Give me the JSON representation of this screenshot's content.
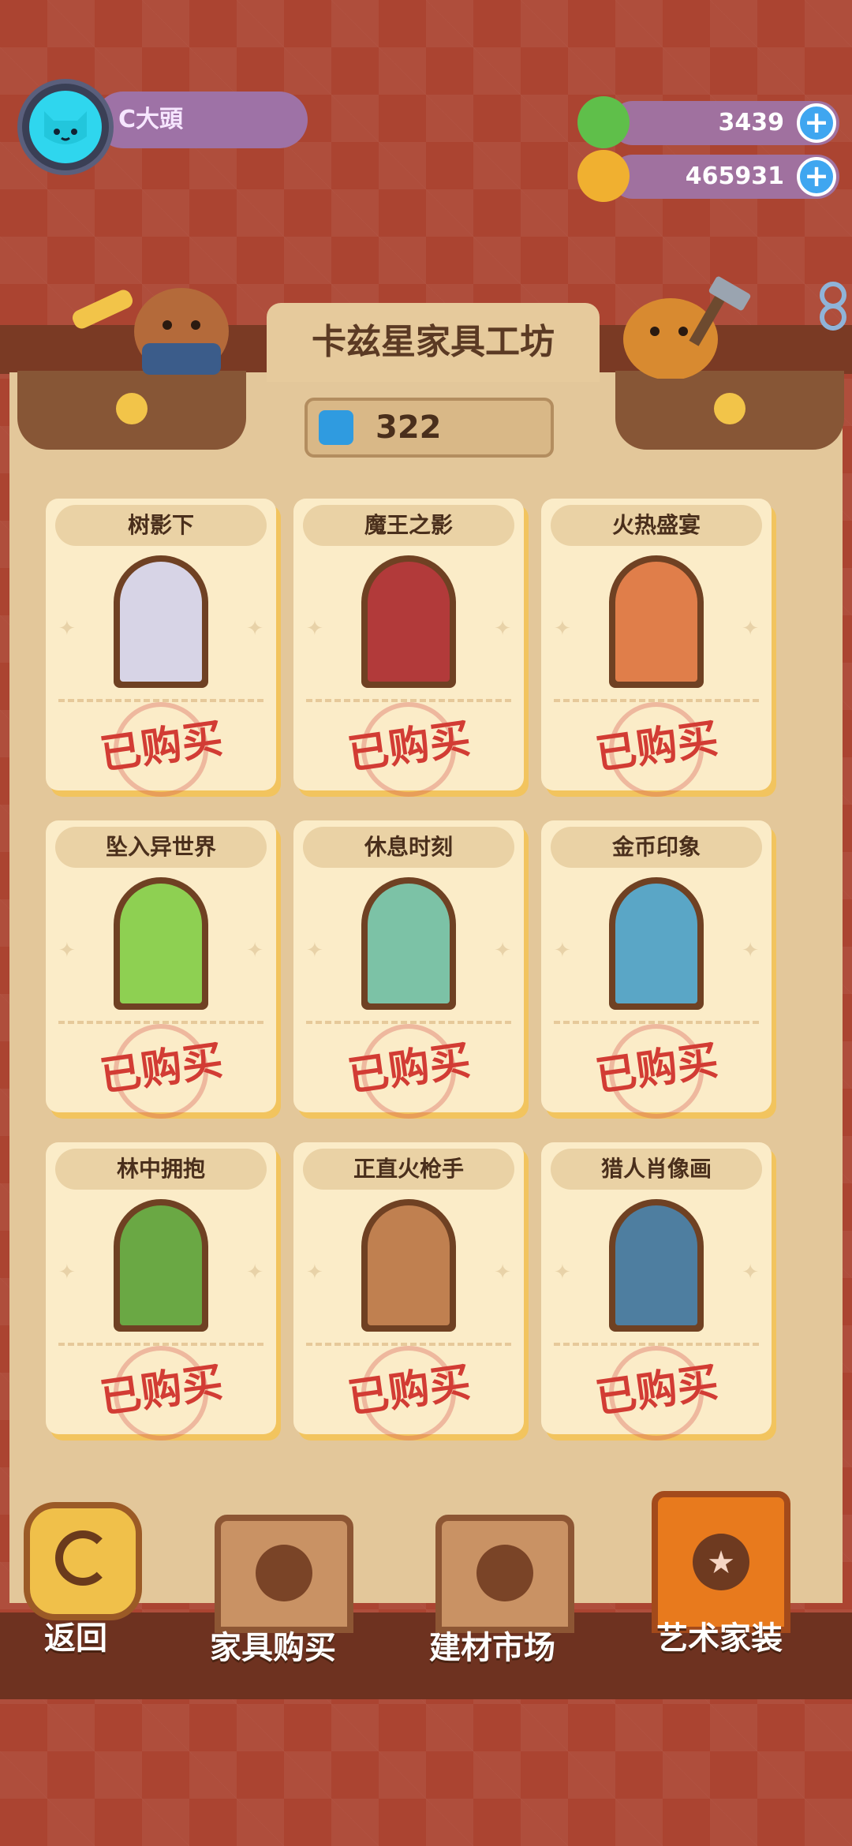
{
  "player": {
    "name": "C大頭"
  },
  "currencies": [
    {
      "name": "green-gem",
      "value": "3439",
      "color": "#5fbf4a"
    },
    {
      "name": "gold-coin",
      "value": "465931",
      "color": "#f0b030"
    }
  ],
  "shop": {
    "title": "卡兹星家具工坊",
    "ticket_count": "322"
  },
  "items": [
    {
      "title": "树影下",
      "status": "已购买",
      "art_color": "#d7d4e6"
    },
    {
      "title": "魔王之影",
      "status": "已购买",
      "art_color": "#b23a3a"
    },
    {
      "title": "火热盛宴",
      "status": "已购买",
      "art_color": "#e07e4a"
    },
    {
      "title": "坠入异世界",
      "status": "已购买",
      "art_color": "#8ed052"
    },
    {
      "title": "休息时刻",
      "status": "已购买",
      "art_color": "#7cc2a6"
    },
    {
      "title": "金币印象",
      "status": "已购买",
      "art_color": "#5aa6c6"
    },
    {
      "title": "林中拥抱",
      "status": "已购买",
      "art_color": "#6aa844"
    },
    {
      "title": "正直火枪手",
      "status": "已购买",
      "art_color": "#c08050"
    },
    {
      "title": "猎人肖像画",
      "status": "已购买",
      "art_color": "#4e7ea0"
    }
  ],
  "nav": {
    "back": "返回",
    "furniture": "家具购买",
    "materials": "建材市场",
    "art": "艺术家装"
  }
}
